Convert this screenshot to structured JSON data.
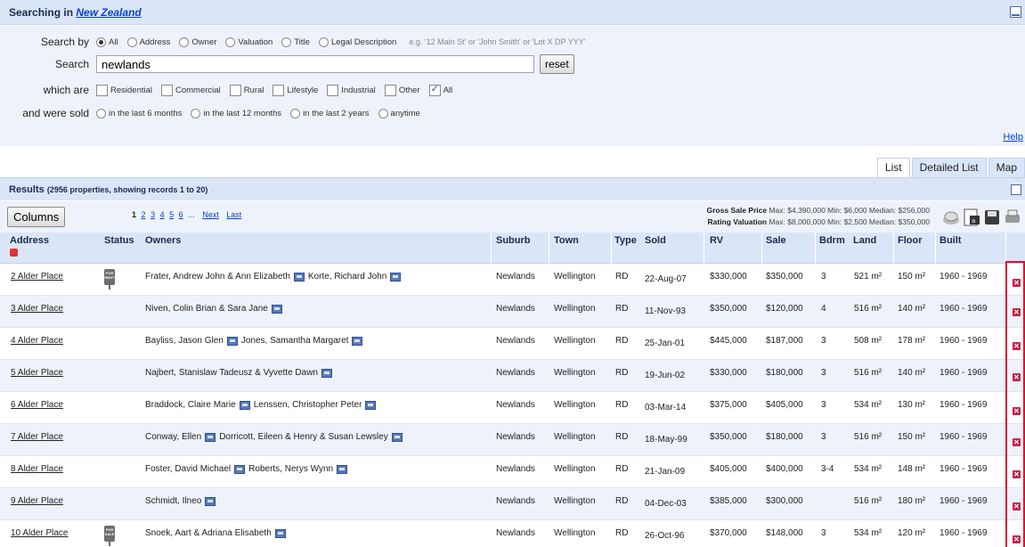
{
  "search": {
    "title_prefix": "Searching in",
    "region": "New Zealand",
    "search_by_label": "Search by",
    "search_by_options": [
      "All",
      "Address",
      "Owner",
      "Valuation",
      "Title",
      "Legal Description"
    ],
    "search_by_selected": "All",
    "hint": "e.g. '12 Main St' or 'John Smith' or 'Lot X DP YYY'",
    "search_label": "Search",
    "search_value": "newlands",
    "reset_label": "reset",
    "which_are_label": "which are",
    "types": [
      {
        "label": "Residential",
        "checked": false
      },
      {
        "label": "Commercial",
        "checked": false
      },
      {
        "label": "Rural",
        "checked": false
      },
      {
        "label": "Lifestyle",
        "checked": false
      },
      {
        "label": "Industrial",
        "checked": false
      },
      {
        "label": "Other",
        "checked": false
      },
      {
        "label": "All",
        "checked": true
      }
    ],
    "sold_label": "and were sold",
    "sold_options": [
      "in the last 6 months",
      "in the last 12 months",
      "in the last 2 years",
      "anytime"
    ],
    "help": "Help"
  },
  "tabs": [
    "List",
    "Detailed List",
    "Map"
  ],
  "active_tab": "List",
  "results": {
    "title": "Results",
    "summary": "(2956 properties, showing records 1 to 20)",
    "columns_button": "Columns",
    "pages": [
      "1",
      "2",
      "3",
      "4",
      "5",
      "6",
      "...",
      "Next",
      "Last"
    ],
    "gross_label": "Gross Sale Price",
    "gross_text": "Max: $4,390,000 Min: $6,000 Median: $256,000",
    "rating_label": "Rating Valuation",
    "rating_text": "Max: $8,000,000 Min: $2,500 Median: $350,000"
  },
  "table": {
    "headers": [
      "Address",
      "Status",
      "Owners",
      "Suburb",
      "Town",
      "Type",
      "Sold",
      "RV",
      "Sale",
      "Bdrm",
      "Land",
      "Floor",
      "Built"
    ],
    "rows": [
      {
        "address": "2 Alder Place",
        "status": "FOR RENT",
        "owners": [
          "Frater, Andrew John & Ann Elizabeth",
          "Korte, Richard John"
        ],
        "suburb": "Newlands",
        "town": "Wellington",
        "type": "RD",
        "sold": "22-Aug-07",
        "rv": "$330,000",
        "sale": "$350,000",
        "bdrm": "3",
        "land": "521 m²",
        "floor": "150 m²",
        "built": "1960 - 1969"
      },
      {
        "address": "3 Alder Place",
        "status": "",
        "owners": [
          "Niven, Colin Brian & Sara Jane"
        ],
        "suburb": "Newlands",
        "town": "Wellington",
        "type": "RD",
        "sold": "11-Nov-93",
        "rv": "$350,000",
        "sale": "$120,000",
        "bdrm": "4",
        "land": "516 m²",
        "floor": "140 m²",
        "built": "1960 - 1969"
      },
      {
        "address": "4 Alder Place",
        "status": "",
        "owners": [
          "Bayliss, Jason Glen",
          "Jones, Samantha Margaret"
        ],
        "suburb": "Newlands",
        "town": "Wellington",
        "type": "RD",
        "sold": "25-Jan-01",
        "rv": "$445,000",
        "sale": "$187,000",
        "bdrm": "3",
        "land": "508 m²",
        "floor": "178 m²",
        "built": "1960 - 1969"
      },
      {
        "address": "5 Alder Place",
        "status": "",
        "owners": [
          "Najbert, Stanislaw Tadeusz & Vyvette Dawn"
        ],
        "suburb": "Newlands",
        "town": "Wellington",
        "type": "RD",
        "sold": "19-Jun-02",
        "rv": "$330,000",
        "sale": "$180,000",
        "bdrm": "3",
        "land": "516 m²",
        "floor": "140 m²",
        "built": "1960 - 1969"
      },
      {
        "address": "6 Alder Place",
        "status": "",
        "owners": [
          "Braddock, Claire Marie",
          "Lenssen, Christopher Peter"
        ],
        "suburb": "Newlands",
        "town": "Wellington",
        "type": "RD",
        "sold": "03-Mar-14",
        "rv": "$375,000",
        "sale": "$405,000",
        "bdrm": "3",
        "land": "534 m²",
        "floor": "130 m²",
        "built": "1960 - 1969"
      },
      {
        "address": "7 Alder Place",
        "status": "",
        "owners": [
          "Conway, Ellen",
          "Dorricott, Eileen & Henry & Susan Lewsley"
        ],
        "suburb": "Newlands",
        "town": "Wellington",
        "type": "RD",
        "sold": "18-May-99",
        "rv": "$350,000",
        "sale": "$180,000",
        "bdrm": "3",
        "land": "516 m²",
        "floor": "150 m²",
        "built": "1960 - 1969"
      },
      {
        "address": "8 Alder Place",
        "status": "",
        "owners": [
          "Foster, David Michael",
          "Roberts, Nerys Wynn"
        ],
        "suburb": "Newlands",
        "town": "Wellington",
        "type": "RD",
        "sold": "21-Jan-09",
        "rv": "$405,000",
        "sale": "$400,000",
        "bdrm": "3-4",
        "land": "534 m²",
        "floor": "148 m²",
        "built": "1960 - 1969"
      },
      {
        "address": "9 Alder Place",
        "status": "",
        "owners": [
          "Schmidt, Ilneo"
        ],
        "suburb": "Newlands",
        "town": "Wellington",
        "type": "RD",
        "sold": "04-Dec-03",
        "rv": "$385,000",
        "sale": "$300,000",
        "bdrm": "",
        "land": "516 m²",
        "floor": "180 m²",
        "built": "1960 - 1969"
      },
      {
        "address": "10 Alder Place",
        "status": "FOR SALE",
        "owners": [
          "Snoek, Aart & Adriana Elisabeth"
        ],
        "suburb": "Newlands",
        "town": "Wellington",
        "type": "RD",
        "sold": "26-Oct-96",
        "rv": "$370,000",
        "sale": "$148,000",
        "bdrm": "3",
        "land": "534 m²",
        "floor": "120 m²",
        "built": "1960 - 1969"
      }
    ]
  },
  "icons": {
    "phone": "phone-icon",
    "delete": "delete-icon",
    "status": "sign-icon"
  },
  "colors": {
    "header_bg": "#dbe5f8",
    "panel_bg": "#eef2fb",
    "link": "#0645c8",
    "delete": "#c0244a",
    "highlight": "#e0102f"
  }
}
